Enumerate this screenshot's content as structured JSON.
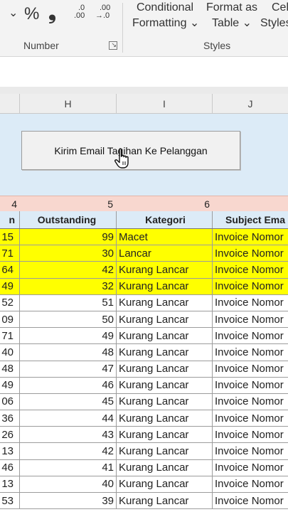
{
  "ribbon": {
    "chevron": "⌄",
    "percent": "%",
    "comma": "❟",
    "decimal_inc_top": ".0",
    "decimal_inc_bottom": ".00",
    "decimal_dec_top": ".00",
    "decimal_dec_bottom": "→.0",
    "conditional_top": "Conditional",
    "conditional_bottom": "Formatting ⌄",
    "format_table_top": "Format as",
    "format_table_bottom": "Table ⌄",
    "cell_styles_top": "Cel",
    "cell_styles_bottom": "Styles",
    "number_group": "Number",
    "styles_group": "Styles"
  },
  "columns": {
    "H": "H",
    "I": "I",
    "J": "J"
  },
  "macro_button": {
    "label": "Kirim Email Tagihan Ke Pelanggan"
  },
  "number_row": {
    "g": "4",
    "h": "5",
    "i": "6"
  },
  "table": {
    "headers": {
      "g": "n",
      "h": "Outstanding",
      "i": "Kategori",
      "j": "Subject Ema"
    },
    "rows": [
      {
        "g": "15",
        "h": "99",
        "i": "Macet",
        "j": "Invoice Nomor",
        "highlight": true
      },
      {
        "g": "71",
        "h": "30",
        "i": "Lancar",
        "j": "Invoice Nomor",
        "highlight": true
      },
      {
        "g": "64",
        "h": "42",
        "i": "Kurang Lancar",
        "j": "Invoice Nomor",
        "highlight": true
      },
      {
        "g": "49",
        "h": "32",
        "i": "Kurang Lancar",
        "j": "Invoice Nomor",
        "highlight": true
      },
      {
        "g": "52",
        "h": "51",
        "i": "Kurang Lancar",
        "j": "Invoice Nomor",
        "highlight": false
      },
      {
        "g": "09",
        "h": "50",
        "i": "Kurang Lancar",
        "j": "Invoice Nomor",
        "highlight": false
      },
      {
        "g": "71",
        "h": "49",
        "i": "Kurang Lancar",
        "j": "Invoice Nomor",
        "highlight": false
      },
      {
        "g": "40",
        "h": "48",
        "i": "Kurang Lancar",
        "j": "Invoice Nomor",
        "highlight": false
      },
      {
        "g": "48",
        "h": "47",
        "i": "Kurang Lancar",
        "j": "Invoice Nomor",
        "highlight": false
      },
      {
        "g": "49",
        "h": "46",
        "i": "Kurang Lancar",
        "j": "Invoice Nomor",
        "highlight": false
      },
      {
        "g": "06",
        "h": "45",
        "i": "Kurang Lancar",
        "j": "Invoice Nomor",
        "highlight": false
      },
      {
        "g": "36",
        "h": "44",
        "i": "Kurang Lancar",
        "j": "Invoice Nomor",
        "highlight": false
      },
      {
        "g": "26",
        "h": "43",
        "i": "Kurang Lancar",
        "j": "Invoice Nomor",
        "highlight": false
      },
      {
        "g": "13",
        "h": "42",
        "i": "Kurang Lancar",
        "j": "Invoice Nomor",
        "highlight": false
      },
      {
        "g": "46",
        "h": "41",
        "i": "Kurang Lancar",
        "j": "Invoice Nomor",
        "highlight": false
      },
      {
        "g": "13",
        "h": "40",
        "i": "Kurang Lancar",
        "j": "Invoice Nomor",
        "highlight": false
      },
      {
        "g": "53",
        "h": "39",
        "i": "Kurang Lancar",
        "j": "Invoice Nomor",
        "highlight": false
      }
    ]
  },
  "colors": {
    "highlight": "#ffff00",
    "header_fill": "#dcebf7",
    "number_row_fill": "#f8d7cf",
    "band_fill": "#dcebf7"
  }
}
